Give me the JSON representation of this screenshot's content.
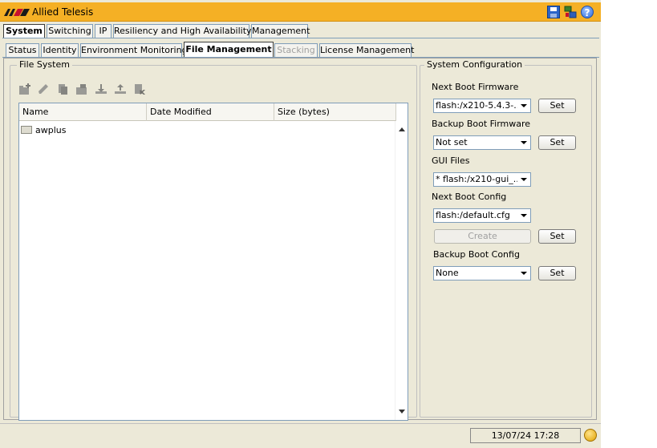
{
  "app": {
    "title": "Allied Telesis",
    "brand_color": "#f5b025"
  },
  "main_tabs": [
    {
      "label": "System",
      "active": true
    },
    {
      "label": "Switching",
      "active": false
    },
    {
      "label": "IP",
      "active": false
    },
    {
      "label": "Resiliency and High Availability",
      "active": false
    },
    {
      "label": "Management",
      "active": false
    }
  ],
  "sub_tabs": [
    {
      "label": "Status",
      "active": false,
      "disabled": false
    },
    {
      "label": "Identity",
      "active": false,
      "disabled": false
    },
    {
      "label": "Environment Monitoring",
      "active": false,
      "disabled": false
    },
    {
      "label": "File Management",
      "active": true,
      "disabled": false
    },
    {
      "label": "Stacking",
      "active": false,
      "disabled": true
    },
    {
      "label": "License Management",
      "active": false,
      "disabled": false
    }
  ],
  "file_system": {
    "legend": "File System",
    "toolbar_icons": [
      "new-folder-icon",
      "rename-icon",
      "copy-icon",
      "open-folder-icon",
      "upload-icon",
      "download-icon",
      "delete-icon"
    ],
    "columns": [
      "Name",
      "Date Modified",
      "Size (bytes)"
    ],
    "rows": [
      {
        "name": "awplus",
        "icon": "folder-icon"
      }
    ]
  },
  "system_configuration": {
    "legend": "System Configuration",
    "next_boot_firmware": {
      "label": "Next Boot Firmware",
      "value": "flash:/x210-5.4.3-...",
      "button": "Set"
    },
    "backup_boot_firmware": {
      "label": "Backup Boot Firmware",
      "value": "Not set",
      "button": "Set"
    },
    "gui_files": {
      "label": "GUI Files",
      "value": "* flash:/x210-gui_..."
    },
    "next_boot_config": {
      "label": "Next Boot Config",
      "value": "flash:/default.cfg",
      "create_button": "Create",
      "button": "Set"
    },
    "backup_boot_config": {
      "label": "Backup Boot Config",
      "value": "None",
      "button": "Set"
    }
  },
  "status_bar": {
    "datetime": "13/07/24 17:28"
  }
}
